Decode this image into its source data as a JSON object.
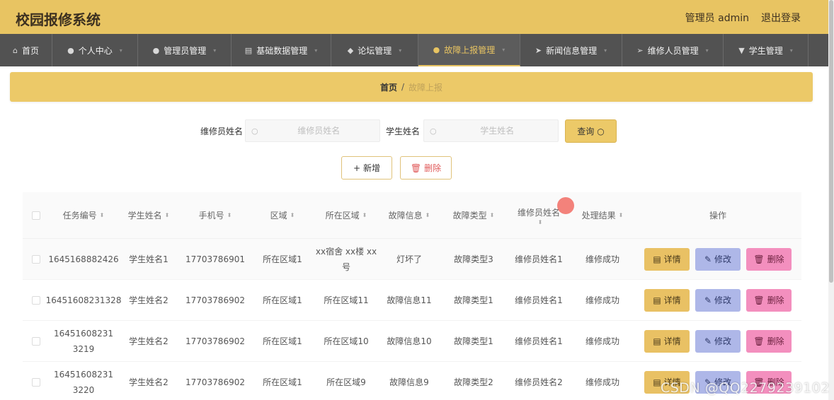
{
  "header": {
    "title": "校园报修系统",
    "admin": "管理员 admin",
    "logout": "退出登录"
  },
  "nav": [
    {
      "label": "首页",
      "icon": "home-icon",
      "active": false
    },
    {
      "label": "个人中心",
      "icon": "user-icon",
      "active": false
    },
    {
      "label": "管理员管理",
      "icon": "admin-icon",
      "active": false
    },
    {
      "label": "基础数据管理",
      "icon": "data-icon",
      "active": false
    },
    {
      "label": "论坛管理",
      "icon": "forum-icon",
      "active": false
    },
    {
      "label": "故障上报管理",
      "icon": "report-icon",
      "active": true
    },
    {
      "label": "新闻信息管理",
      "icon": "news-icon",
      "active": false
    },
    {
      "label": "维修人员管理",
      "icon": "repairman-icon",
      "active": false
    },
    {
      "label": "学生管理",
      "icon": "student-icon",
      "active": false
    }
  ],
  "breadcrumb": {
    "home": "首页",
    "separator": "/",
    "current": "故障上报"
  },
  "search": {
    "repairman_label": "维修员姓名",
    "repairman_placeholder": "维修员姓名",
    "student_label": "学生姓名",
    "student_placeholder": "学生姓名",
    "query_button": "查询"
  },
  "actions": {
    "add": "新增",
    "delete": "删除"
  },
  "table": {
    "headers": [
      "任务编号",
      "学生姓名",
      "手机号",
      "区域",
      "所在区域",
      "故障信息",
      "故障类型",
      "维修员姓名",
      "处理结果",
      "操作"
    ],
    "rows": [
      {
        "task_no": "1645168882426",
        "student": "学生姓名1",
        "phone": "17703786901",
        "area": "所在区域1",
        "location": "xx宿舍 xx楼 xx号",
        "fault_info": "灯坏了",
        "fault_type": "故障类型3",
        "repairman": "维修员姓名1",
        "result": "维修成功"
      },
      {
        "task_no": "16451608231328",
        "student": "学生姓名2",
        "phone": "17703786902",
        "area": "所在区域1",
        "location": "所在区域11",
        "fault_info": "故障信息11",
        "fault_type": "故障类型1",
        "repairman": "维修员姓名1",
        "result": "维修成功"
      },
      {
        "task_no": "16451608231 3219",
        "student": "学生姓名2",
        "phone": "17703786902",
        "area": "所在区域1",
        "location": "所在区域10",
        "fault_info": "故障信息10",
        "fault_type": "故障类型1",
        "repairman": "维修员姓名1",
        "result": "维修成功"
      },
      {
        "task_no": "16451608231 3220",
        "student": "学生姓名2",
        "phone": "17703786902",
        "area": "所在区域1",
        "location": "所在区域9",
        "fault_info": "故障信息9",
        "fault_type": "故障类型2",
        "repairman": "维修员姓名2",
        "result": "维修成功"
      }
    ],
    "op_detail": "详情",
    "op_edit": "修改",
    "op_delete": "删除"
  },
  "watermark": "CSDN @QQ2279239102",
  "colors": {
    "header_bg": "#e8c462",
    "nav_bg": "#525252",
    "detail_btn": "#e9c164",
    "edit_btn": "#aeb7e8",
    "delete_btn": "#f38fbe"
  }
}
